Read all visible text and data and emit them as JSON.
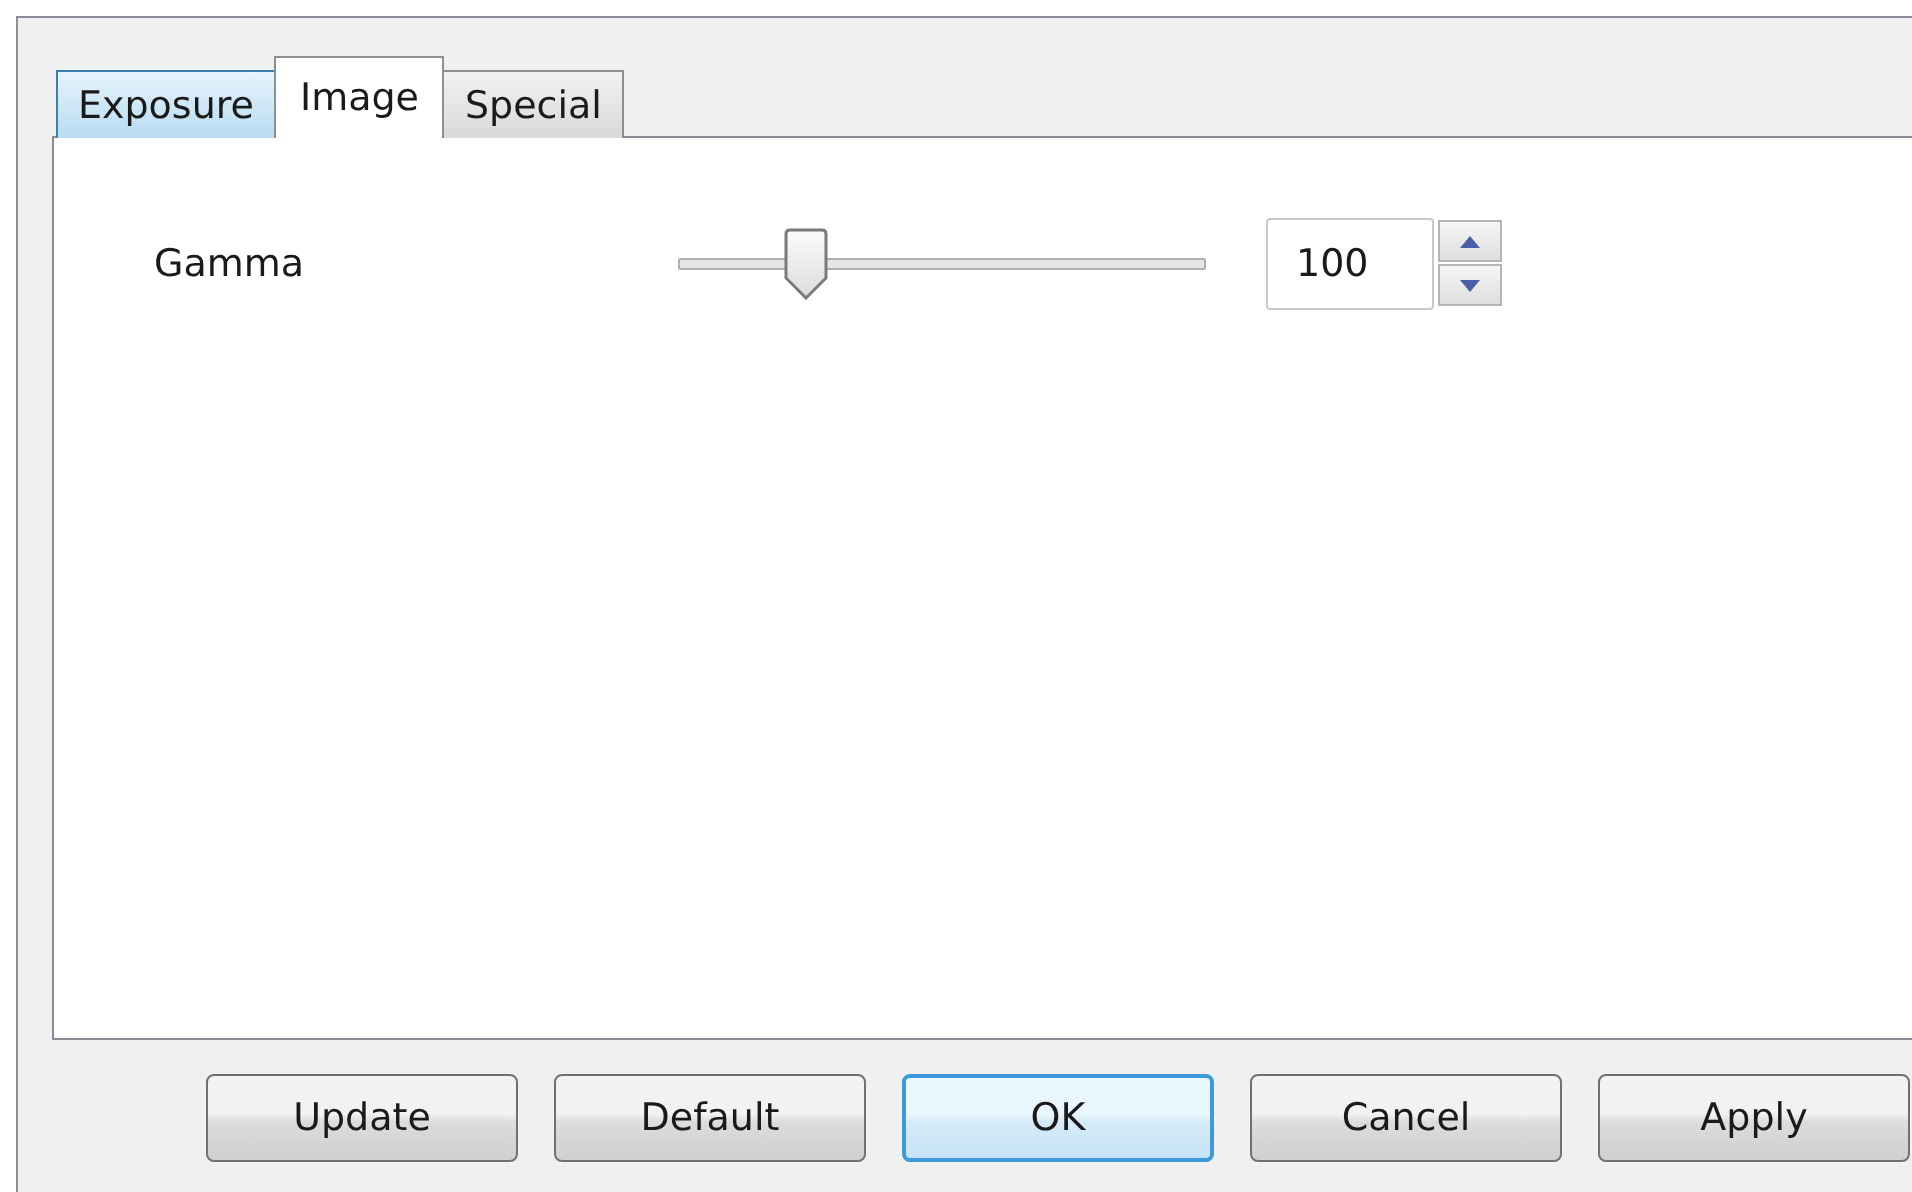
{
  "tabs": [
    {
      "label": "Exposure",
      "selected": false,
      "hovered": true
    },
    {
      "label": "Image",
      "selected": true,
      "hovered": false
    },
    {
      "label": "Special",
      "selected": false,
      "hovered": false
    }
  ],
  "settings": [
    {
      "label": "Gamma",
      "level": 0.22,
      "value": "100"
    }
  ],
  "buttons": [
    {
      "label": "Update",
      "default": false
    },
    {
      "label": "Default",
      "default": false
    },
    {
      "label": "OK",
      "default": true
    },
    {
      "label": "Cancel",
      "default": false
    },
    {
      "label": "Apply",
      "default": false
    }
  ]
}
